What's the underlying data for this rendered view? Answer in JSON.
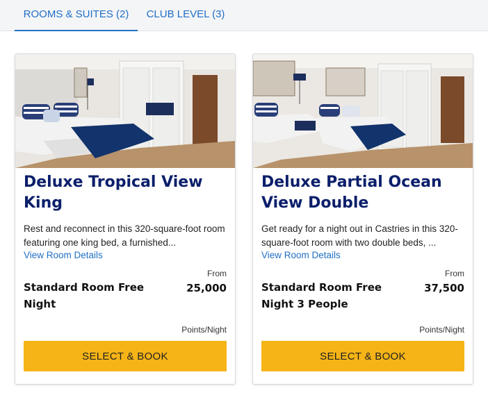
{
  "tabs": [
    {
      "label": "ROOMS & SUITES (2)",
      "active": true
    },
    {
      "label": "CLUB LEVEL (3)",
      "active": false
    }
  ],
  "colors": {
    "accent": "#1f6fc5",
    "title": "#0b1f6b",
    "button": "#f6b416"
  },
  "rooms": [
    {
      "title": "Deluxe Tropical View King",
      "description": "Rest and reconnect in this 320-square-foot room featuring one king bed, a furnished...",
      "details_link": "View Room Details",
      "rate_name": "Standard Room Free Night",
      "from_label": "From",
      "points": "25,000",
      "unit_label": "Points/Night",
      "button_label": "SELECT & BOOK"
    },
    {
      "title": "Deluxe Partial Ocean View Double",
      "description": "Get ready for a night out in Castries in this 320-square-foot room with two double beds, ...",
      "details_link": "View Room Details",
      "rate_name": "Standard Room Free Night 3 People",
      "from_label": "From",
      "points": "37,500",
      "unit_label": "Points/Night",
      "button_label": "SELECT & BOOK"
    }
  ]
}
